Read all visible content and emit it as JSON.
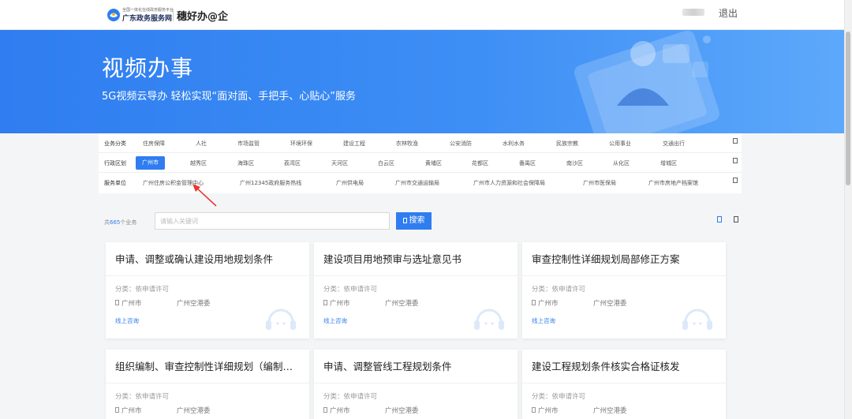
{
  "header": {
    "logo_small": "全国一体化在线政务服务平台",
    "logo_main": "广东政务服务网",
    "brand": "穗好办@企",
    "logout": "退出"
  },
  "banner": {
    "title": "视频办事",
    "subtitle": "5G视频云导办 轻松实现“面对面、手把手、心贴心”服务"
  },
  "filters": {
    "business_label": "业务分类",
    "business": [
      "住房保障",
      "人社",
      "市场监管",
      "环境环保",
      "建设工程",
      "农林牧渔",
      "公安消防",
      "水利水务",
      "民族宗教",
      "公用事业",
      "交通出行"
    ],
    "district_label": "行政区划",
    "district_selected": "广州市",
    "district": [
      "越秀区",
      "海珠区",
      "荔湾区",
      "天河区",
      "白云区",
      "黄埔区",
      "花都区",
      "番禺区",
      "南沙区",
      "从化区",
      "增城区"
    ],
    "unit_label": "服务单位",
    "units": [
      "广州住房公积金管理中心",
      "广州12345政府服务热线",
      "广州供电局",
      "广州市交通运输局",
      "广州市人力资源和社会保障局",
      "广州市医保局",
      "广州市房地产档案馆"
    ]
  },
  "search": {
    "count_prefix": "共",
    "count_value": "665",
    "count_suffix": "个业务",
    "placeholder": "请输入关键词",
    "button": "搜索"
  },
  "cards": [
    {
      "title": "申请、调整或确认建设用地规划条件",
      "category": "分类：依申请许可",
      "location": "广州市",
      "dept": "广州空港委",
      "consult": "线上咨询"
    },
    {
      "title": "建设项目用地预审与选址意见书",
      "category": "分类：依申请许可",
      "location": "广州市",
      "dept": "广州空港委",
      "consult": "线上咨询"
    },
    {
      "title": "审查控制性详细规划局部修正方案",
      "category": "分类：依申请许可",
      "location": "广州市",
      "dept": "广州空港委",
      "consult": "线上咨询"
    },
    {
      "title": "组织编制、审查控制性详细规划（编制、...",
      "category": "分类：依申请许可",
      "location": "广州市",
      "dept": "广州空港委",
      "consult": ""
    },
    {
      "title": "申请、调整管线工程规划条件",
      "category": "分类：依申请许可",
      "location": "广州市",
      "dept": "广州空港委",
      "consult": ""
    },
    {
      "title": "建设工程规划条件核实合格证核发",
      "category": "分类：依申请许可",
      "location": "广州市",
      "dept": "广州空港委",
      "consult": ""
    }
  ],
  "colors": {
    "accent": "#2f7df0",
    "annotation": "#e8382f"
  }
}
